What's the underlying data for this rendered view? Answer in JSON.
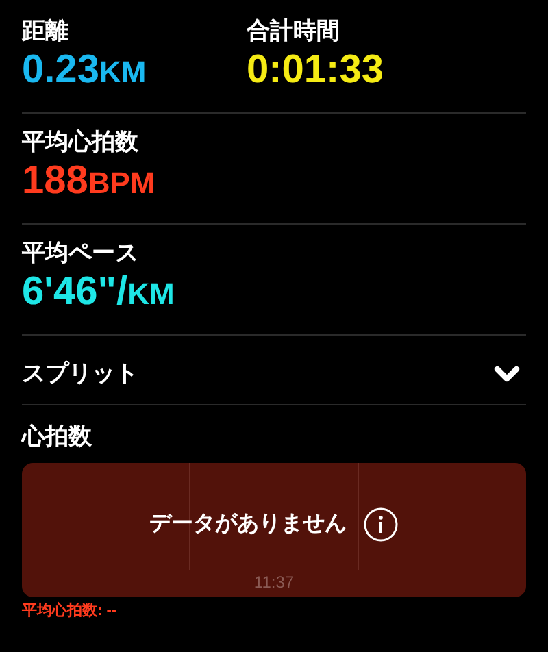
{
  "metric_rows": [
    {
      "metrics": [
        {
          "label": "距離",
          "value": "0.23",
          "unit": "KM",
          "color": "#1ab8f0"
        },
        {
          "label": "合計時間",
          "value": "0:01:33",
          "color": "#f5eb14"
        }
      ]
    },
    {
      "metrics": [
        {
          "label": "平均心拍数",
          "value": "188",
          "unit": "BPM",
          "color": "#ff3b1e"
        }
      ]
    },
    {
      "metrics": [
        {
          "label": "平均ペース",
          "value": "6'46\"/",
          "unit": "KM",
          "color": "#1ee6e6"
        }
      ]
    }
  ],
  "splits": {
    "label": "スプリット",
    "expanded": false
  },
  "heart_rate": {
    "title": "心拍数",
    "message": "データがありません",
    "time_label": "11:37",
    "summary": "平均心拍数: --"
  }
}
